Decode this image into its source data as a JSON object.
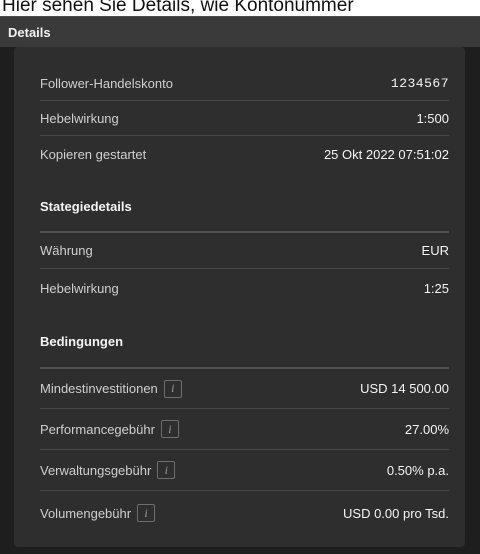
{
  "caption": "Hier sehen Sie Details, wie Kontonummer",
  "panel": {
    "title": "Details"
  },
  "account": {
    "rows": [
      {
        "label": "Follower-Handelskonto",
        "value": "1234567"
      },
      {
        "label": "Hebelwirkung",
        "value": "1:500"
      },
      {
        "label": "Kopieren gestartet",
        "value": "25 Okt 2022 07:51:02"
      }
    ]
  },
  "strategy": {
    "heading": "Stategiedetails",
    "rows": [
      {
        "label": "Währung",
        "value": "EUR"
      },
      {
        "label": "Hebelwirkung",
        "value": "1:25"
      }
    ]
  },
  "conditions": {
    "heading": "Bedingungen",
    "info_glyph": "i",
    "rows": [
      {
        "label": "Mindestinvestitionen",
        "value": "USD 14 500.00"
      },
      {
        "label": "Performancegebühr",
        "value": "27.00%"
      },
      {
        "label": "Verwaltungsgebühr",
        "value": "0.50% p.a."
      },
      {
        "label": "Volumengebühr",
        "value": "USD 0.00 pro Tsd."
      }
    ]
  }
}
